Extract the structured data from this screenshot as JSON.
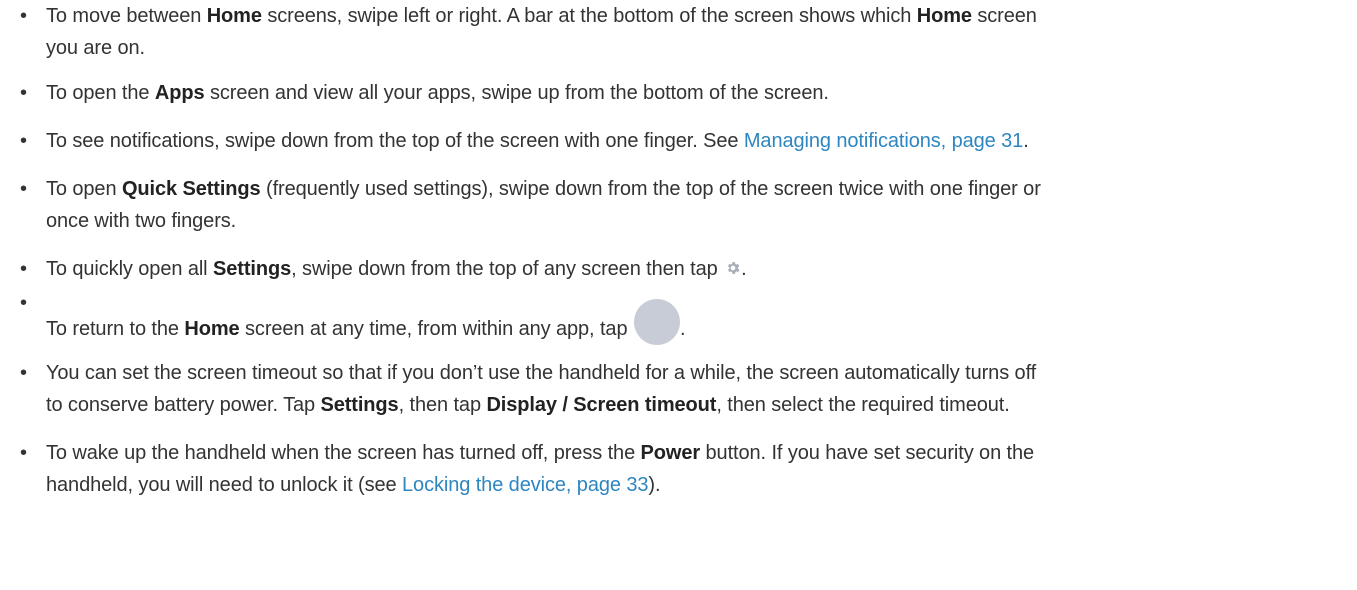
{
  "bullets": [
    {
      "segments": [
        {
          "text": "To move between ",
          "style": "normal"
        },
        {
          "text": "Home",
          "style": "bold"
        },
        {
          "text": " screens, swipe left or right. A bar at the bottom of the screen shows which ",
          "style": "normal"
        },
        {
          "text": "Home",
          "style": "bold"
        },
        {
          "text": " screen",
          "style": "normal"
        }
      ],
      "continuation": "you are on."
    },
    {
      "segments": [
        {
          "text": "To open the ",
          "style": "normal"
        },
        {
          "text": "Apps",
          "style": "bold"
        },
        {
          "text": " screen and view all your apps, swipe up from the bottom of the screen.",
          "style": "normal"
        }
      ]
    },
    {
      "segments": [
        {
          "text": "To see notifications, swipe down from the top of the screen with one finger. See ",
          "style": "normal"
        },
        {
          "text": "Managing notifications, page 31",
          "style": "link"
        },
        {
          "text": ".",
          "style": "normal"
        }
      ]
    },
    {
      "segments": [
        {
          "text": "To open ",
          "style": "normal"
        },
        {
          "text": "Quick Settings",
          "style": "bold"
        },
        {
          "text": " (frequently used settings), swipe down from the top of the screen twice with one finger or",
          "style": "normal"
        }
      ],
      "continuation": "once with two fingers."
    },
    {
      "segments": [
        {
          "text": "To quickly open all ",
          "style": "normal"
        },
        {
          "text": "Settings",
          "style": "bold"
        },
        {
          "text": ", swipe down from the top of any screen then tap ",
          "style": "normal"
        },
        {
          "text": ".",
          "style": "normal"
        }
      ],
      "icon": "gear-icon"
    },
    {
      "segments": [
        {
          "text": "To return to the ",
          "style": "normal"
        },
        {
          "text": "Home",
          "style": "bold"
        },
        {
          "text": " screen at any time, from within any app, tap ",
          "style": "normal"
        },
        {
          "text": ".",
          "style": "normal"
        }
      ],
      "icon": "home-button-icon"
    },
    {
      "segments": [
        {
          "text": "You can set the screen timeout so that if you don’t use the handheld for a while, the screen automatically turns off",
          "style": "normal"
        }
      ],
      "continuation_segments": [
        {
          "text": "to conserve battery power. Tap ",
          "style": "normal"
        },
        {
          "text": "Settings",
          "style": "bold"
        },
        {
          "text": ", then tap ",
          "style": "normal"
        },
        {
          "text": "Display / Screen timeout",
          "style": "bold"
        },
        {
          "text": ", then select the required timeout.",
          "style": "normal"
        }
      ]
    },
    {
      "segments": [
        {
          "text": "To wake up the handheld when the screen has turned off, press the ",
          "style": "normal"
        },
        {
          "text": "Power",
          "style": "bold"
        },
        {
          "text": " button. If you have set security on the",
          "style": "normal"
        }
      ],
      "continuation_segments": [
        {
          "text": "handheld, you will need to unlock it (see ",
          "style": "normal"
        },
        {
          "text": "Locking the device, page 33",
          "style": "link"
        },
        {
          "text": ").",
          "style": "normal"
        }
      ]
    }
  ],
  "bullet_glyph": "•",
  "colors": {
    "text": "#333333",
    "link": "#2e86c1",
    "home_button": "#c8ccd6",
    "gear": "#a9adb8"
  }
}
